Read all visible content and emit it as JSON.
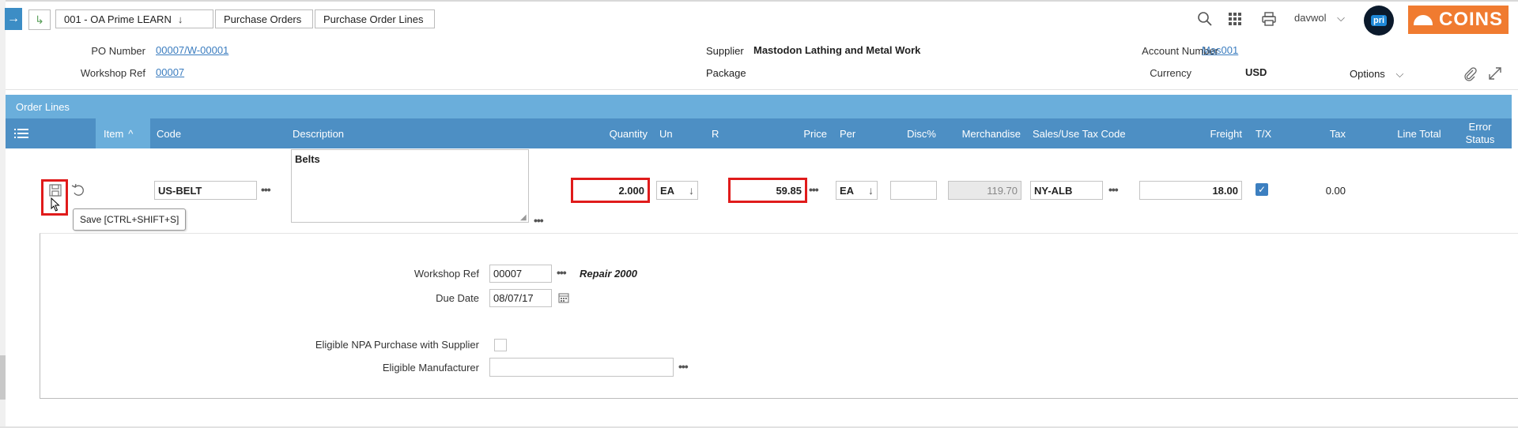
{
  "topbar": {
    "nav_arrow": "→",
    "home_icon": "↳",
    "breadcrumbs": [
      {
        "label": "001 - OA Prime LEARN",
        "has_dropdown": true
      },
      {
        "label": "Purchase Orders"
      },
      {
        "label": "Purchase Order Lines"
      }
    ],
    "user": "davwol",
    "avatar_text": "pri",
    "logo_text": "COINS",
    "brand_color": "#f07b30"
  },
  "header": {
    "po_number_label": "PO Number",
    "po_number": "00007/W-00001",
    "workshop_ref_label": "Workshop Ref",
    "workshop_ref": "00007",
    "supplier_label": "Supplier",
    "supplier": "Mastodon Lathing and Metal Work",
    "package_label": "Package",
    "package": "",
    "account_number_label": "Account Number",
    "account_number": "Mas001",
    "currency_label": "Currency",
    "currency": "USD",
    "options_label": "Options"
  },
  "order_lines": {
    "section_title": "Order Lines",
    "columns": [
      "Item",
      "Code",
      "Description",
      "Quantity",
      "Un",
      "R",
      "Price",
      "Per",
      "Disc%",
      "Merchandise",
      "Sales/Use Tax Code",
      "Freight",
      "T/X",
      "Tax",
      "Line Total",
      "Error Status"
    ],
    "row": {
      "code": "US-BELT",
      "description": "Belts",
      "quantity": "2.000",
      "unit": "EA",
      "price": "59.85",
      "per": "EA",
      "disc": "",
      "merchandise": "119.70",
      "tax_code": "NY-ALB",
      "freight": "18.00",
      "tx_checked": true,
      "tax": "0.00"
    },
    "save_tooltip": "Save [CTRL+SHIFT+S]"
  },
  "detail": {
    "workshop_ref_label": "Workshop Ref",
    "workshop_ref": "00007",
    "workshop_desc": "Repair 2000",
    "due_date_label": "Due Date",
    "due_date": "08/07/17",
    "npa_label": "Eligible NPA Purchase with Supplier",
    "npa_checked": false,
    "manufacturer_label": "Eligible Manufacturer",
    "manufacturer": ""
  }
}
